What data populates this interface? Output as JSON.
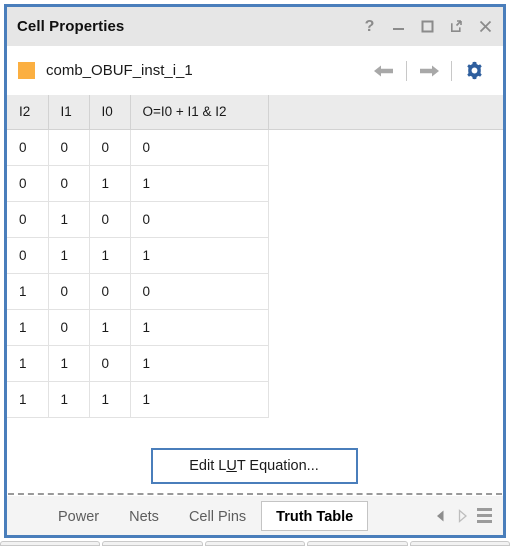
{
  "window": {
    "title": "Cell Properties",
    "border_color": "#4a7ebb",
    "titlebar_buttons": [
      {
        "name": "help-icon",
        "label": "?"
      },
      {
        "name": "minimize-icon",
        "label": "Minimize"
      },
      {
        "name": "maximize-icon",
        "label": "Maximize"
      },
      {
        "name": "float-icon",
        "label": "Float"
      },
      {
        "name": "close-icon",
        "label": "Close"
      }
    ]
  },
  "object": {
    "name": "comb_OBUF_inst_i_1",
    "swatch_color": "#fbaf41",
    "nav": {
      "back": "Back",
      "forward": "Forward",
      "settings": "Settings"
    }
  },
  "truth_table": {
    "columns": [
      "I2",
      "I1",
      "I0",
      "O=I0 + I1 & I2"
    ],
    "rows": [
      [
        "0",
        "0",
        "0",
        "0"
      ],
      [
        "0",
        "0",
        "1",
        "1"
      ],
      [
        "0",
        "1",
        "0",
        "0"
      ],
      [
        "0",
        "1",
        "1",
        "1"
      ],
      [
        "1",
        "0",
        "0",
        "0"
      ],
      [
        "1",
        "0",
        "1",
        "1"
      ],
      [
        "1",
        "1",
        "0",
        "1"
      ],
      [
        "1",
        "1",
        "1",
        "1"
      ]
    ]
  },
  "actions": {
    "edit_lut_prefix": "Edit L",
    "edit_lut_mnemonic": "U",
    "edit_lut_suffix": "T Equation..."
  },
  "tabs": {
    "items": [
      {
        "label": "Power",
        "active": false
      },
      {
        "label": "Nets",
        "active": false
      },
      {
        "label": "Cell Pins",
        "active": false
      },
      {
        "label": "Truth Table",
        "active": true
      }
    ],
    "scroll_left": "Scroll tabs left",
    "scroll_right": "Scroll tabs right",
    "menu": "Tab list menu"
  }
}
